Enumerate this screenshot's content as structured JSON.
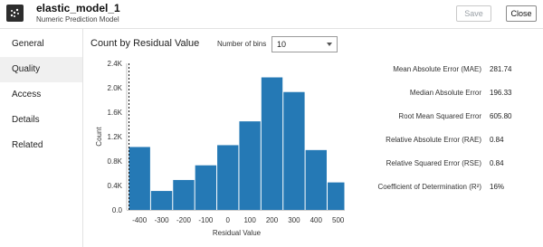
{
  "header": {
    "model_name": "elastic_model_1",
    "model_type": "Numeric Prediction Model",
    "save_label": "Save",
    "close_label": "Close"
  },
  "sidebar": {
    "items": [
      {
        "label": "General",
        "active": false
      },
      {
        "label": "Quality",
        "active": true
      },
      {
        "label": "Access",
        "active": false
      },
      {
        "label": "Details",
        "active": false
      },
      {
        "label": "Related",
        "active": false
      }
    ]
  },
  "panel": {
    "title": "Count by Residual Value",
    "bins_label": "Number of bins",
    "bins_value": "10"
  },
  "metrics": [
    {
      "label": "Mean Absolute Error (MAE)",
      "value": "281.74"
    },
    {
      "label": "Median Absolute Error",
      "value": "196.33"
    },
    {
      "label": "Root Mean Squared Error",
      "value": "605.80"
    },
    {
      "label": "Relative Absolute Error (RAE)",
      "value": "0.84"
    },
    {
      "label": "Relative Squared Error (RSE)",
      "value": "0.84"
    },
    {
      "label": "Coefficient of Determination (R²)",
      "value": "16%"
    }
  ],
  "colors": {
    "bar": "#2579b5",
    "accent": "#2d2d2d"
  },
  "chart_data": {
    "type": "bar",
    "xlabel": "Residual Value",
    "ylabel": "Count",
    "ylim": [
      0,
      2400
    ],
    "yticks": [
      0,
      400,
      800,
      1200,
      1600,
      2000,
      2400
    ],
    "ytick_labels": [
      "0.0",
      "0.4K",
      "0.8K",
      "1.2K",
      "1.6K",
      "2.0K",
      "2.4K"
    ],
    "xlim": [
      -450,
      530
    ],
    "xticks": [
      -400,
      -300,
      -200,
      -100,
      0,
      100,
      200,
      300,
      400,
      500
    ],
    "bins": [
      {
        "from": -450,
        "to": -350,
        "count": 1030
      },
      {
        "from": -350,
        "to": -250,
        "count": 310
      },
      {
        "from": -250,
        "to": -150,
        "count": 490
      },
      {
        "from": -150,
        "to": -50,
        "count": 730
      },
      {
        "from": -50,
        "to": 50,
        "count": 1060
      },
      {
        "from": 50,
        "to": 150,
        "count": 1450
      },
      {
        "from": 150,
        "to": 250,
        "count": 2170
      },
      {
        "from": 250,
        "to": 350,
        "count": 1930
      },
      {
        "from": 350,
        "to": 450,
        "count": 980
      },
      {
        "from": 450,
        "to": 530,
        "count": 450
      }
    ],
    "dashed_reference_at": -450
  }
}
